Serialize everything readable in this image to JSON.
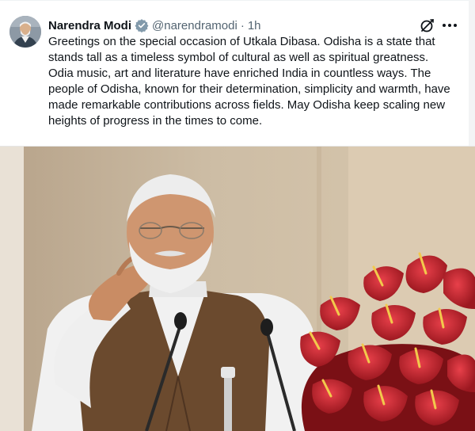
{
  "author": {
    "name": "Narendra Modi",
    "handle": "@narendramodi",
    "separator": "·",
    "time": "1h"
  },
  "tweet": {
    "text": "Greetings on the special occasion of Utkala Dibasa. Odisha is a state that stands tall as a timeless symbol of cultural as well as spiritual greatness. Odia music, art and literature have enriched India in countless ways. The people of Odisha, known for their determination, simplicity and warmth, have made remarkable contributions across fields. May Odisha keep scaling new heights of progress in the times to come."
  },
  "icons": {
    "verified": "verified-badge-icon",
    "grok": "grok-icon",
    "more": "more-options-icon"
  },
  "colors": {
    "text_primary": "#0f1419",
    "text_secondary": "#536471",
    "verified_badge": "#829aab",
    "flowers": "#c8242b",
    "vest": "#6b4a2e"
  }
}
